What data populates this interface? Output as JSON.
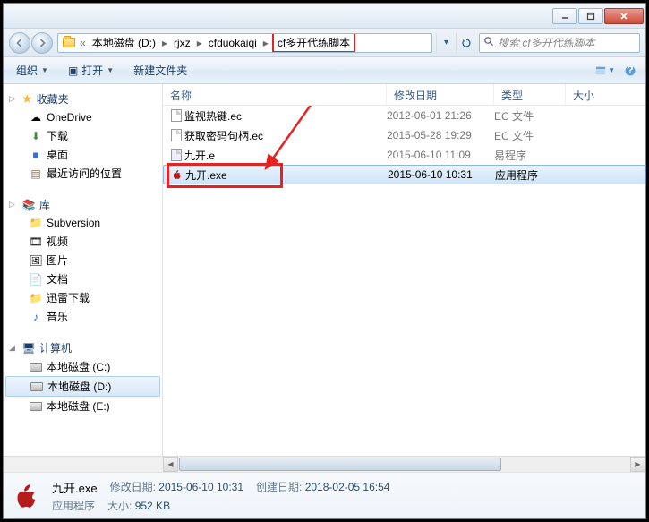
{
  "titlebar": {
    "min": "—",
    "max": "▢",
    "close": "X"
  },
  "address": {
    "back_sep": "«",
    "crumb1": "本地磁盘 (D:)",
    "crumb2": "rjxz",
    "crumb3": "cfduokaiqi",
    "crumb4": "cf多开代练脚本",
    "sep": "▸",
    "refresh_drop": "▾",
    "refresh": "↻"
  },
  "search": {
    "placeholder": "搜索 cf多开代练脚本"
  },
  "toolbar": {
    "organize": "组织",
    "open": "打开",
    "newfolder": "新建文件夹",
    "open_icon": "▣"
  },
  "nav": {
    "fav": {
      "label": "收藏夹",
      "items": [
        {
          "icon": "cloud",
          "label": "OneDrive"
        },
        {
          "icon": "dl",
          "label": "下载"
        },
        {
          "icon": "desktop",
          "label": "桌面"
        },
        {
          "icon": "recent",
          "label": "最近访问的位置"
        }
      ]
    },
    "lib": {
      "label": "库",
      "items": [
        {
          "icon": "svn",
          "label": "Subversion"
        },
        {
          "icon": "video",
          "label": "视频"
        },
        {
          "icon": "pic",
          "label": "图片"
        },
        {
          "icon": "doc",
          "label": "文档"
        },
        {
          "icon": "thunder",
          "label": "迅雷下载"
        },
        {
          "icon": "music",
          "label": "音乐"
        }
      ]
    },
    "pc": {
      "label": "计算机",
      "items": [
        {
          "icon": "drive-c",
          "label": "本地磁盘 (C:)"
        },
        {
          "icon": "drive-d",
          "label": "本地磁盘 (D:)",
          "selected": true
        },
        {
          "icon": "drive-e",
          "label": "本地磁盘 (E:)"
        }
      ]
    }
  },
  "columns": {
    "name": "名称",
    "date": "修改日期",
    "type": "类型",
    "size": "大小"
  },
  "files": [
    {
      "icon": "ec",
      "name": "监视热键.ec",
      "date": "2012-06-01 21:26",
      "type": "EC 文件"
    },
    {
      "icon": "ec",
      "name": "获取密码句柄.ec",
      "date": "2015-05-28 19:29",
      "type": "EC 文件"
    },
    {
      "icon": "e",
      "name": "九开.e",
      "date": "2015-06-10 11:09",
      "type": "易程序"
    },
    {
      "icon": "exe",
      "name": "九开.exe",
      "date": "2015-06-10 10:31",
      "type": "应用程序",
      "selected": true
    }
  ],
  "details": {
    "name": "九开.exe",
    "type": "应用程序",
    "mdate_label": "修改日期:",
    "mdate": "2015-06-10 10:31",
    "cdate_label": "创建日期:",
    "cdate": "2018-02-05 16:54",
    "size_label": "大小:",
    "size": "952 KB"
  }
}
